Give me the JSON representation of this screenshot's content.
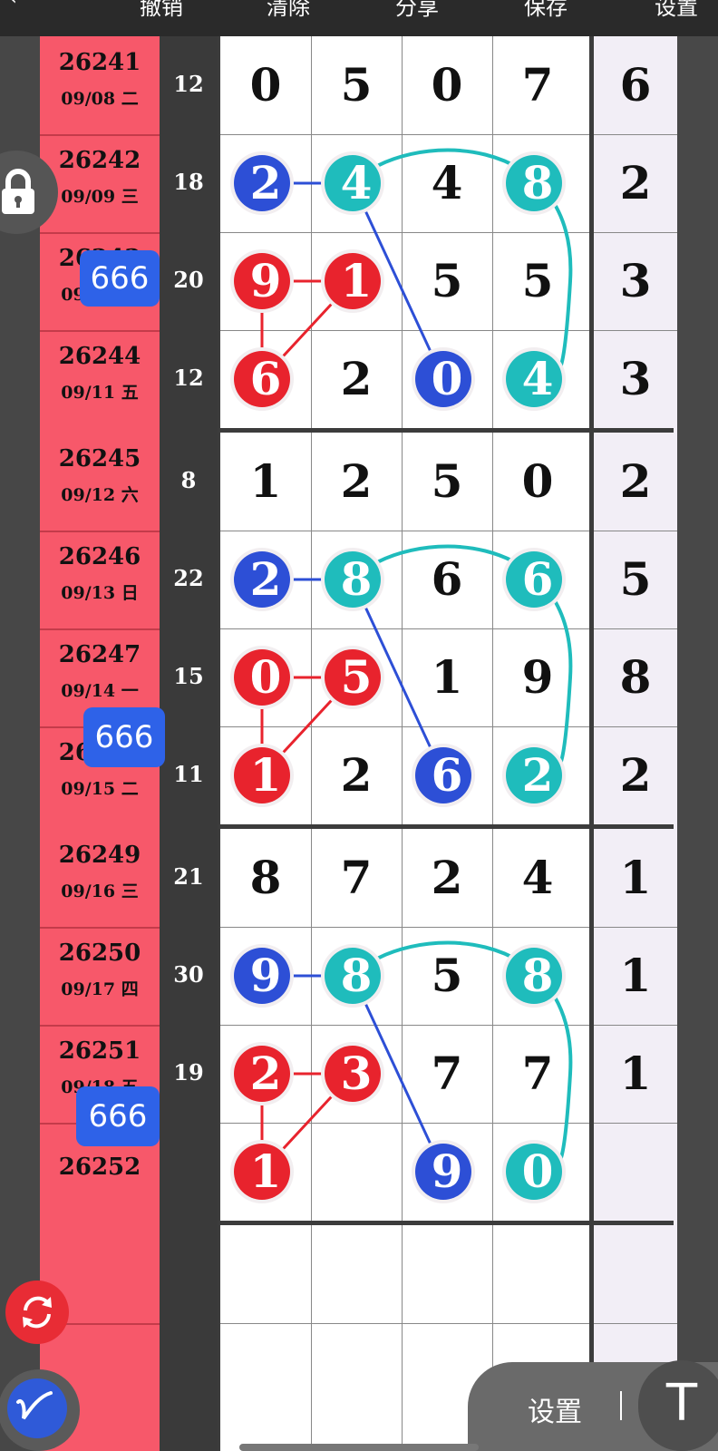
{
  "toolbar": {
    "back_icon": "chevron-left-icon",
    "undo": "撤销",
    "clear": "清除",
    "share": "分享",
    "save": "保存",
    "settings": "设置"
  },
  "rows": [
    {
      "issue": "26241",
      "date": "09/08 二",
      "sum": "12",
      "digits": [
        "0",
        "5",
        "0",
        "7",
        "6"
      ]
    },
    {
      "issue": "26242",
      "date": "09/09 三",
      "sum": "18",
      "digits": [
        "2",
        "4",
        "4",
        "8",
        "2"
      ]
    },
    {
      "issue": "26243",
      "date": "09/10 四",
      "sum": "20",
      "digits": [
        "9",
        "1",
        "5",
        "5",
        "3"
      ]
    },
    {
      "issue": "26244",
      "date": "09/11 五",
      "sum": "12",
      "digits": [
        "6",
        "2",
        "0",
        "4",
        "3"
      ]
    },
    {
      "issue": "26245",
      "date": "09/12 六",
      "sum": "8",
      "digits": [
        "1",
        "2",
        "5",
        "0",
        "2"
      ]
    },
    {
      "issue": "26246",
      "date": "09/13 日",
      "sum": "22",
      "digits": [
        "2",
        "8",
        "6",
        "6",
        "5"
      ]
    },
    {
      "issue": "26247",
      "date": "09/14 一",
      "sum": "15",
      "digits": [
        "0",
        "5",
        "1",
        "9",
        "8"
      ]
    },
    {
      "issue": "26248",
      "date": "09/15 二",
      "sum": "11",
      "digits": [
        "1",
        "2",
        "6",
        "2",
        "2"
      ]
    },
    {
      "issue": "26249",
      "date": "09/16 三",
      "sum": "21",
      "digits": [
        "8",
        "7",
        "2",
        "4",
        "1"
      ]
    },
    {
      "issue": "26250",
      "date": "09/17 四",
      "sum": "30",
      "digits": [
        "9",
        "8",
        "5",
        "8",
        "1"
      ]
    },
    {
      "issue": "26251",
      "date": "09/18 五",
      "sum": "19",
      "digits": [
        "2",
        "3",
        "7",
        "7",
        "1"
      ]
    },
    {
      "issue": "26252",
      "date": "",
      "sum": "",
      "digits": [
        "1",
        "",
        "9",
        "0",
        ""
      ]
    }
  ],
  "badges": [
    "666",
    "666",
    "666"
  ],
  "colors": {
    "red": "#e8232d",
    "blue": "#2d4fd6",
    "teal": "#1fbcbc",
    "date_bg": "#f7586a",
    "last_col_bg": "#f2eef6"
  },
  "bottom": {
    "settings": "设置",
    "text_tool": "T"
  },
  "icons": {
    "lock": "lock-icon",
    "refresh": "refresh-icon",
    "pen": "pen-icon",
    "text": "text-tool-icon"
  }
}
